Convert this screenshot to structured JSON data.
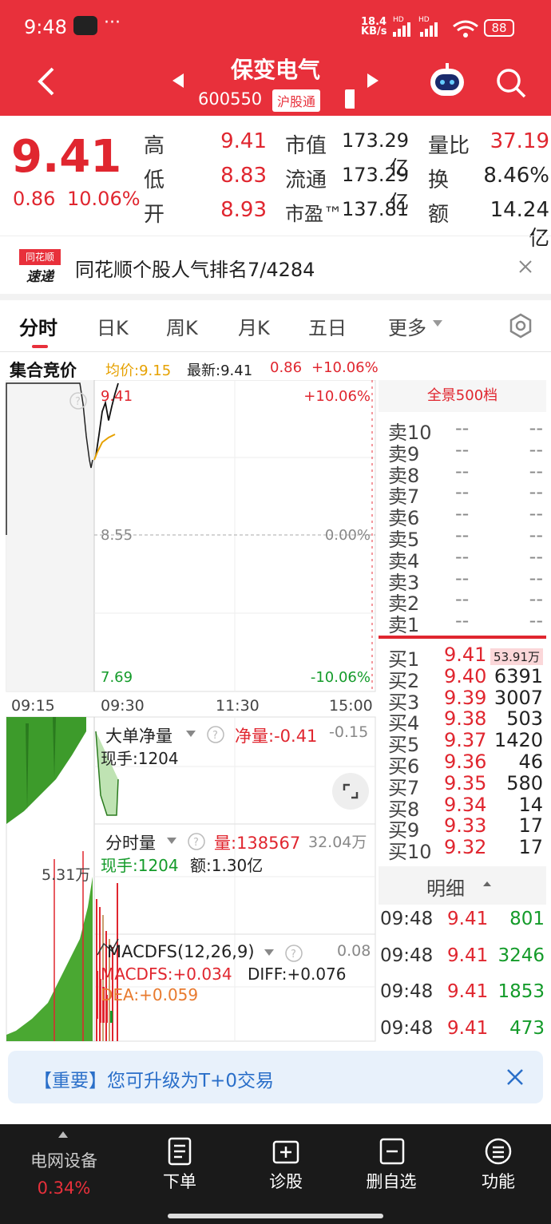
{
  "status": {
    "time": "9:48",
    "dots": "···",
    "net_speed": "18.4",
    "net_unit": "KB/s",
    "battery": "88",
    "hd1": "HD",
    "hd2": "HD"
  },
  "header": {
    "title": "保变电气",
    "code": "600550",
    "badge": "沪股通"
  },
  "quote": {
    "price": "9.41",
    "change": "0.86",
    "change_pct": "10.06%",
    "fields": [
      {
        "label": "高",
        "value": "9.41",
        "color": "red"
      },
      {
        "label": "低",
        "value": "8.83",
        "color": "red"
      },
      {
        "label": "开",
        "value": "8.93",
        "color": "red"
      }
    ],
    "mid": [
      {
        "label": "市值",
        "value": "173.29亿"
      },
      {
        "label": "流通",
        "value": "173.29亿"
      },
      {
        "label": "市盈™",
        "value": "137.81"
      }
    ],
    "right": [
      {
        "label": "量比",
        "value": "37.19",
        "color": "red"
      },
      {
        "label": "换",
        "value": "8.46%",
        "color": "dark"
      },
      {
        "label": "额",
        "value": "14.24亿",
        "color": "dark"
      }
    ]
  },
  "news": {
    "logo_top": "同花顺",
    "logo_bottom": "速递",
    "text": "同花顺个股人气排名7/4284"
  },
  "tabs": [
    "分时",
    "日K",
    "周K",
    "月K",
    "五日",
    "更多"
  ],
  "chart_header": {
    "auction": "集合竞价",
    "avg": "均价:9.15",
    "latest": "最新:9.41",
    "change": "0.86",
    "pct": "+10.06%"
  },
  "chart_data": {
    "type": "line",
    "x_ticks": [
      "09:15",
      "09:30",
      "11:30",
      "15:00"
    ],
    "y_left": [
      "9.41",
      "8.55",
      "7.69"
    ],
    "y_right": [
      "+10.06%",
      "0.00%",
      "-10.06%"
    ],
    "ylim": [
      7.69,
      9.41
    ],
    "price_series": [
      {
        "t": "09:30",
        "v": 9.0
      },
      {
        "t": "09:31",
        "v": 9.12
      },
      {
        "t": "09:32",
        "v": 9.25
      },
      {
        "t": "09:33",
        "v": 9.3
      },
      {
        "t": "09:34",
        "v": 9.2
      },
      {
        "t": "09:35",
        "v": 9.28
      },
      {
        "t": "09:36",
        "v": 9.35
      },
      {
        "t": "09:37",
        "v": 9.41
      }
    ]
  },
  "panel1": {
    "title": "大单净量",
    "net": "净量:-0.41",
    "right": "-0.15",
    "hand": "现手:1204"
  },
  "panel2": {
    "title": "分时量",
    "vol": "量:138567",
    "right": "32.04万",
    "hand": "现手:1204",
    "amount": "额:1.30亿",
    "left_label": "5.31万"
  },
  "panel3": {
    "title": "MACDFS(12,26,9)",
    "right": "0.08",
    "macd": "MACDFS:+0.034",
    "diff": "DIFF:+0.076",
    "dea": "DEA:+0.059"
  },
  "orderbook": {
    "title": "全景500档",
    "sells": [
      {
        "l": "卖10",
        "p": "--",
        "v": "--"
      },
      {
        "l": "卖9",
        "p": "--",
        "v": "--"
      },
      {
        "l": "卖8",
        "p": "--",
        "v": "--"
      },
      {
        "l": "卖7",
        "p": "--",
        "v": "--"
      },
      {
        "l": "卖6",
        "p": "--",
        "v": "--"
      },
      {
        "l": "卖5",
        "p": "--",
        "v": "--"
      },
      {
        "l": "卖4",
        "p": "--",
        "v": "--"
      },
      {
        "l": "卖3",
        "p": "--",
        "v": "--"
      },
      {
        "l": "卖2",
        "p": "--",
        "v": "--"
      },
      {
        "l": "卖1",
        "p": "--",
        "v": "--"
      }
    ],
    "buys": [
      {
        "l": "买1",
        "p": "9.41",
        "v": "53.91万"
      },
      {
        "l": "买2",
        "p": "9.40",
        "v": "6391"
      },
      {
        "l": "买3",
        "p": "9.39",
        "v": "3007"
      },
      {
        "l": "买4",
        "p": "9.38",
        "v": "503"
      },
      {
        "l": "买5",
        "p": "9.37",
        "v": "1420"
      },
      {
        "l": "买6",
        "p": "9.36",
        "v": "46"
      },
      {
        "l": "买7",
        "p": "9.35",
        "v": "580"
      },
      {
        "l": "买8",
        "p": "9.34",
        "v": "14"
      },
      {
        "l": "买9",
        "p": "9.33",
        "v": "17"
      },
      {
        "l": "买10",
        "p": "9.32",
        "v": "17"
      }
    ]
  },
  "detail": {
    "title": "明细",
    "rows": [
      {
        "t": "09:48",
        "p": "9.41",
        "v": "801"
      },
      {
        "t": "09:48",
        "p": "9.41",
        "v": "3246"
      },
      {
        "t": "09:48",
        "p": "9.41",
        "v": "1853"
      },
      {
        "t": "09:48",
        "p": "9.41",
        "v": "473"
      }
    ]
  },
  "banner": {
    "text": "【重要】您可升级为T+0交易"
  },
  "bottom": {
    "sector": "电网设备",
    "sector_pct": "0.34%",
    "items": [
      "下单",
      "诊股",
      "删自选",
      "功能"
    ]
  },
  "colors": {
    "brand_red": "#e8303b",
    "up": "#e0262f",
    "down": "#149b2a"
  }
}
